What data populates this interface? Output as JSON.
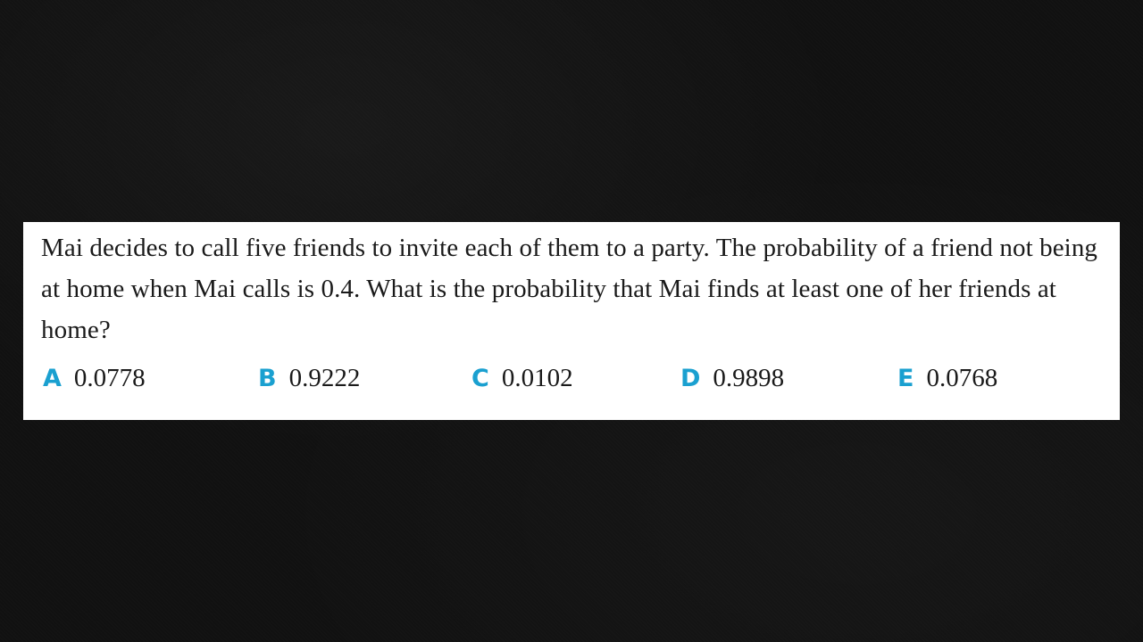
{
  "question": {
    "text": "Mai decides to call five friends to invite each of them to a party. The probability of a friend not being at home when Mai calls is 0.4. What is the probability that Mai finds at least one of her friends at home?"
  },
  "answers": [
    {
      "letter": "A",
      "value": "0.0778"
    },
    {
      "letter": "B",
      "value": "0.9222"
    },
    {
      "letter": "C",
      "value": "0.0102"
    },
    {
      "letter": "D",
      "value": "0.9898"
    },
    {
      "letter": "E",
      "value": "0.0768"
    }
  ],
  "colors": {
    "background": "#111111",
    "card": "#ffffff",
    "answer_letter": "#1aa0d0",
    "text": "#1a1a1a"
  }
}
